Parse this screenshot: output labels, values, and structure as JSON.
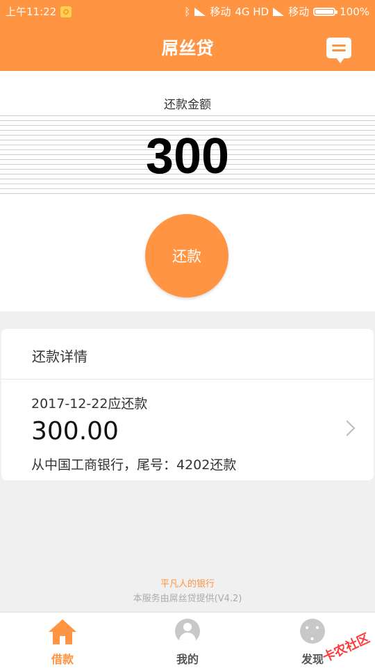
{
  "status_bar": {
    "time": "上午11:22",
    "carrier1": "移动",
    "network": "4G HD",
    "carrier2": "移动",
    "battery": "100%"
  },
  "header": {
    "title": "屌丝贷"
  },
  "repay": {
    "amount_label": "还款金额",
    "amount": "300",
    "button_label": "还款"
  },
  "details": {
    "title": "还款详情",
    "due_date_text": "2017-12-22应还款",
    "amount": "300.00",
    "bank_text": "从中国工商银行，尾号：4202还款"
  },
  "footer": {
    "slogan": "平凡人的银行",
    "note": "本服务由屌丝贷提供(V4.2)"
  },
  "tabs": [
    {
      "label": "借款",
      "icon": "home-icon"
    },
    {
      "label": "我的",
      "icon": "user-icon"
    },
    {
      "label": "发现",
      "icon": "more-icon"
    }
  ],
  "watermark": "卡农社区",
  "colors": {
    "accent": "#ff9442"
  }
}
